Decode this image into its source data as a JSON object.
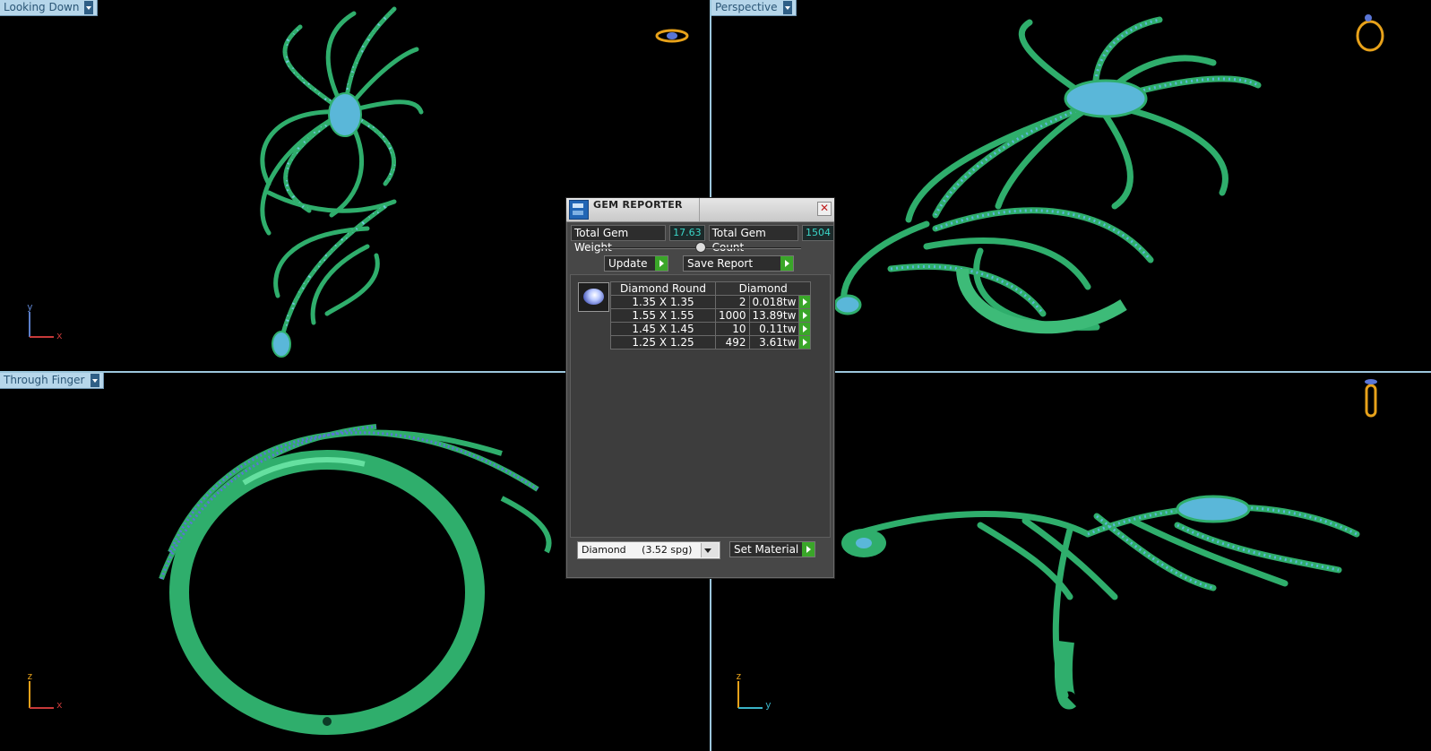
{
  "viewports": {
    "top_left": {
      "label": "Looking Down"
    },
    "top_right": {
      "label": "Perspective"
    },
    "bottom_left": {
      "label": "Through Finger"
    }
  },
  "axes": {
    "top_left": {
      "v": "y",
      "h": "x"
    },
    "bottom_left": {
      "v": "z",
      "h": "x"
    },
    "bottom_right": {
      "v": "z",
      "h": "y"
    }
  },
  "gem_reporter": {
    "title": "GEM REPORTER",
    "total_weight_label": "Total Gem Weight",
    "total_weight_value": "17.63",
    "total_count_label": "Total Gem Count",
    "total_count_value": "1504",
    "update_label": "Update",
    "save_report_label": "Save Report",
    "table": {
      "header_shape": "Diamond Round",
      "header_material": "Diamond",
      "rows": [
        {
          "size": "1.35 X 1.35",
          "count": "2",
          "weight": "0.018tw"
        },
        {
          "size": "1.55 X 1.55",
          "count": "1000",
          "weight": "13.89tw"
        },
        {
          "size": "1.45 X 1.45",
          "count": "10",
          "weight": "0.11tw"
        },
        {
          "size": "1.25 X 1.25",
          "count": "492",
          "weight": "3.61tw"
        }
      ]
    },
    "material_select": "Diamond     (3.52 spg)",
    "set_material_label": "Set Material"
  },
  "colors": {
    "metal": "#2fae6c",
    "gems": "#5ab7d9",
    "accent_go": "#3aa629",
    "viewport_label_bg": "#b6d6ea"
  },
  "icons": {
    "top_left_corner": "ring-top-view-icon",
    "top_right_corner": "ring-perspective-icon",
    "bottom_right_corner": "ring-side-view-icon"
  }
}
